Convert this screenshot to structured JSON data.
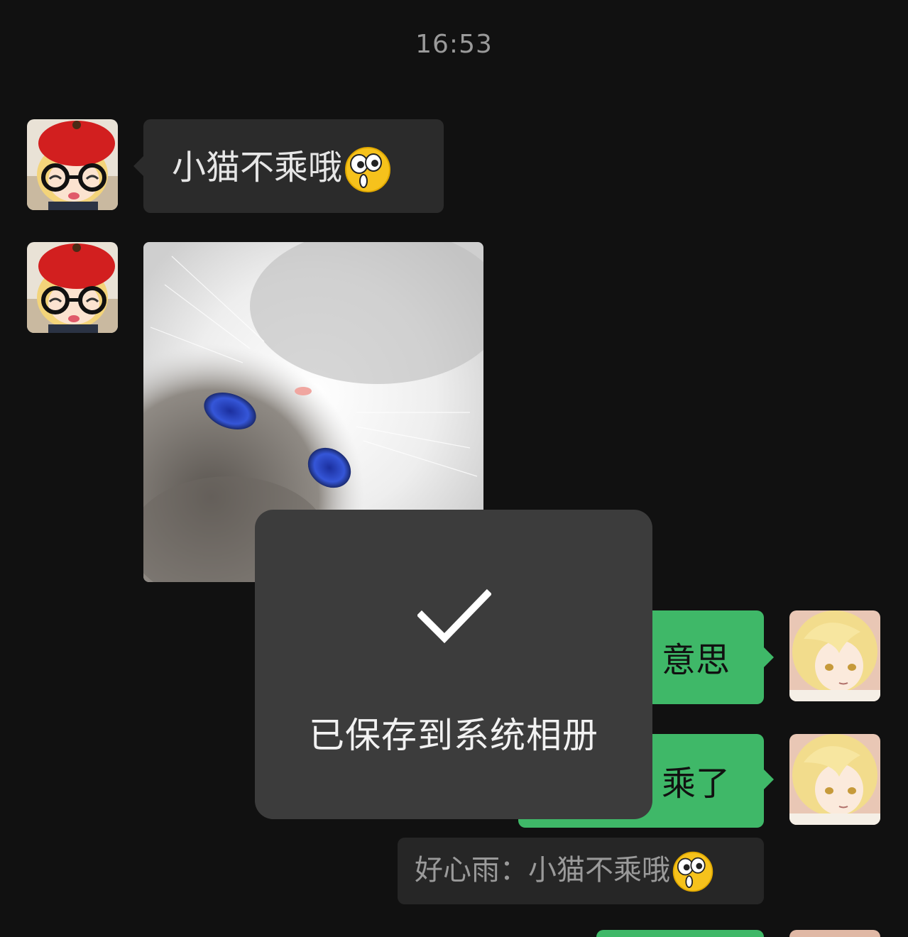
{
  "chat": {
    "timestamp": "16:53",
    "messages": [
      {
        "side": "left",
        "type": "text",
        "text": "小猫不乘哦",
        "emoji": "surprised-face-icon"
      },
      {
        "side": "left",
        "type": "image",
        "content": "cat-photo"
      },
      {
        "side": "right",
        "type": "text",
        "text": "意思"
      },
      {
        "side": "right",
        "type": "text",
        "text": "乘了"
      }
    ],
    "quote": {
      "text": "好心雨：小猫不乘哦",
      "emoji": "surprised-face-icon"
    }
  },
  "toast": {
    "text": "已保存到系统相册",
    "icon": "checkmark-icon"
  },
  "colors": {
    "background": "#111111",
    "incoming_bubble": "#2b2b2b",
    "outgoing_bubble": "#3fb868",
    "toast_bg": "#3c3c3c"
  }
}
